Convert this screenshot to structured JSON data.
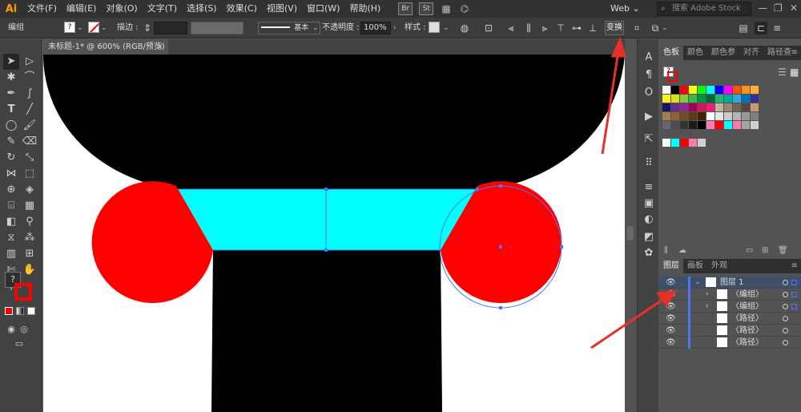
{
  "app": {
    "logo": "Ai"
  },
  "menu": [
    "文件(F)",
    "编辑(E)",
    "对象(O)",
    "文字(T)",
    "选择(S)",
    "效果(C)",
    "视图(V)",
    "窗口(W)",
    "帮助(H)"
  ],
  "menubar_buttons": {
    "bridge": "Br",
    "stock": "St"
  },
  "workspace": "Web",
  "stock_search_placeholder": "搜索 Adobe Stock",
  "control_bar": {
    "selection_label": "编组",
    "fill_value": "?",
    "stroke_label": "描边 :",
    "stroke_style": "基本",
    "opacity_label": "不透明度 :",
    "opacity_value": "100%",
    "style_label": "样式 :",
    "transform_label": "变换"
  },
  "document_tab": {
    "title": "未标题-1* @ 600% (RGB/预览)",
    "close": "×"
  },
  "toolbox": {
    "fill_unknown": "?"
  },
  "color_panel": {
    "tabs": [
      "色板",
      "颜色",
      "颜色参",
      "对齐",
      "路径查"
    ],
    "fill_unknown": "?",
    "colors": {
      "black": "#000000",
      "cyan": "#00ffff",
      "red": "#ff0000",
      "white": "#ffffff",
      "accent_blue": "#4a76ff",
      "annotation_red": "#e8302a"
    }
  },
  "layers_panel": {
    "tabs": [
      "图层",
      "画板",
      "外观"
    ],
    "layers": [
      {
        "name": "图层 1",
        "level": 0,
        "expanded": true
      },
      {
        "name": "〈编组〉",
        "level": 1,
        "expanded": false
      },
      {
        "name": "〈编组〉",
        "level": 1,
        "expanded": false
      },
      {
        "name": "〈路径〉",
        "level": 1
      },
      {
        "name": "〈路径〉",
        "level": 1
      },
      {
        "name": "〈路径〉",
        "level": 1
      }
    ]
  }
}
